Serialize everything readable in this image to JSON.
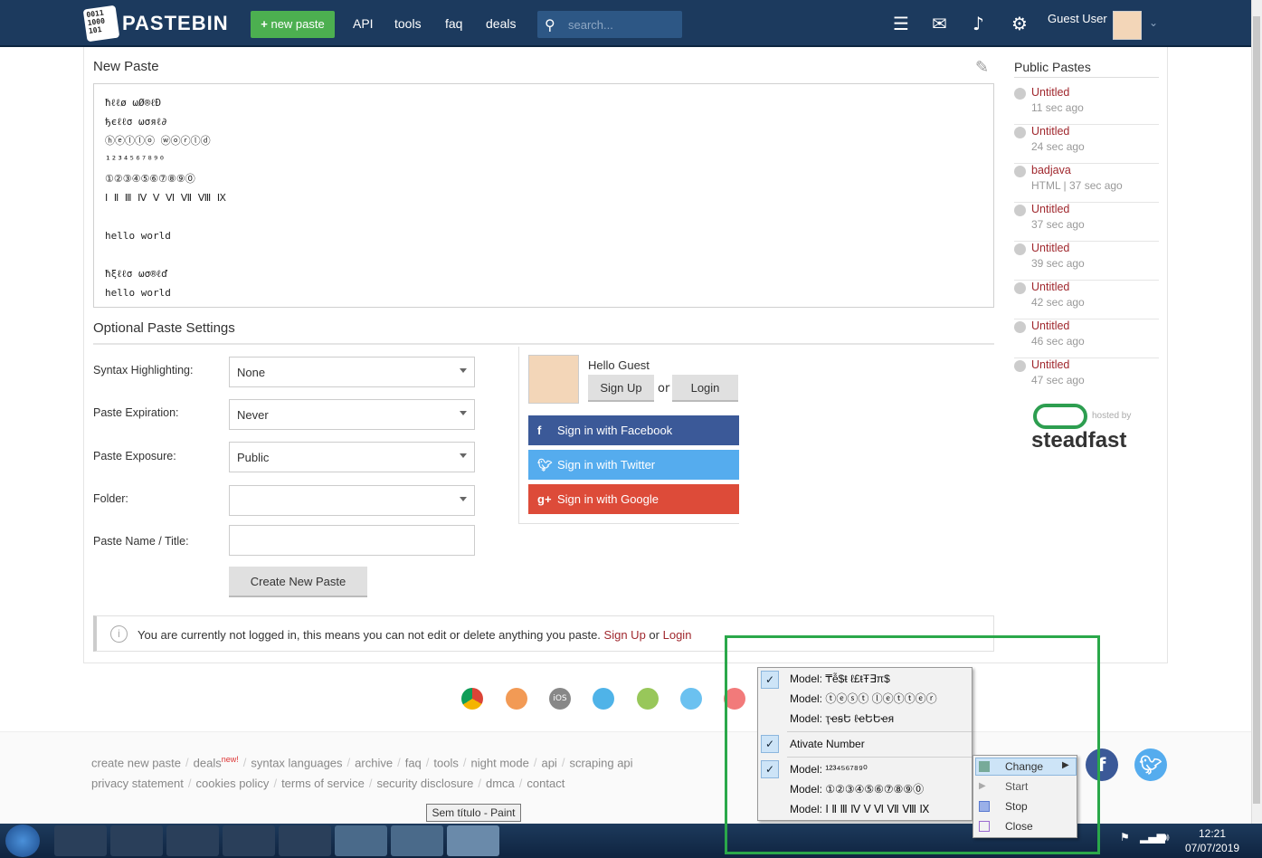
{
  "header": {
    "logo_text": "PASTEBIN",
    "logo_bits": "0011\n1000\n101",
    "new_paste": "new paste",
    "nav": [
      "API",
      "tools",
      "faq",
      "deals"
    ],
    "search_placeholder": "search...",
    "user": "Guest User"
  },
  "editor": {
    "title": "New Paste",
    "content": "ħℓℓø ωØ®ℓÐ\nђєℓℓσ ωσяℓ∂\nⓗⓔⓛⓛⓞ ⓦⓞⓡⓛⓓ\n¹²³⁴⁵⁶⁷⁸⁹⁰\n①②③④⑤⑥⑦⑧⑨⓪\nⅠ Ⅱ Ⅲ Ⅳ Ⅴ Ⅵ Ⅶ Ⅷ Ⅸ\n\nhello world\n\nħξℓℓσ ωσ®ℓď\nhello world"
  },
  "settings": {
    "title": "Optional Paste Settings",
    "rows": [
      {
        "label": "Syntax Highlighting:",
        "value": "None"
      },
      {
        "label": "Paste Expiration:",
        "value": "Never"
      },
      {
        "label": "Paste Exposure:",
        "value": "Public"
      },
      {
        "label": "Folder:",
        "value": ""
      }
    ],
    "name_label": "Paste Name / Title:",
    "create_button": "Create New Paste"
  },
  "login": {
    "hello": "Hello Guest",
    "signup": "Sign Up",
    "or": "or",
    "login": "Login",
    "facebook": "Sign in with Facebook",
    "twitter": "Sign in with Twitter",
    "google": "Sign in with Google"
  },
  "notice": {
    "text": "You are currently not logged in, this means you can not edit or delete anything you paste.",
    "signup": "Sign Up",
    "or": "or",
    "login": "Login"
  },
  "public_pastes": {
    "title": "Public Pastes",
    "items": [
      {
        "title": "Untitled",
        "age": "11 sec ago"
      },
      {
        "title": "Untitled",
        "age": "24 sec ago"
      },
      {
        "title": "badjava",
        "age": "HTML | 37 sec ago"
      },
      {
        "title": "Untitled",
        "age": "37 sec ago"
      },
      {
        "title": "Untitled",
        "age": "39 sec ago"
      },
      {
        "title": "Untitled",
        "age": "42 sec ago"
      },
      {
        "title": "Untitled",
        "age": "46 sec ago"
      },
      {
        "title": "Untitled",
        "age": "47 sec ago"
      }
    ],
    "hosted_by": "hosted by",
    "host": "steadfast"
  },
  "footer": {
    "row1": [
      "create new paste",
      "deals",
      "syntax languages",
      "archive",
      "faq",
      "tools",
      "night mode",
      "api",
      "scraping api"
    ],
    "deals_badge": "new!",
    "row2": [
      "privacy statement",
      "cookies policy",
      "terms of service",
      "security disclosure",
      "dmca",
      "contact"
    ]
  },
  "tooltip": "Sem título - Paint",
  "context_menu": {
    "items": [
      {
        "label": "Model: ₸ễ$ŧ ℓ£ŧŦ∃π$",
        "checked": true
      },
      {
        "label": "Model: ⓣⓔⓢⓣ ⓛⓔⓣⓣⓔⓡ",
        "checked": false
      },
      {
        "label": "Model: ҭҽꞩԵ ℓҽԵԵҽя",
        "checked": false
      },
      {
        "label": "Ativate Number",
        "checked": true
      },
      {
        "label": "Model: ¹²³⁴⁵⁶⁷⁸⁹⁰",
        "checked": true
      },
      {
        "label": "Model: ①②③④⑤⑥⑦⑧⑨⓪",
        "checked": false
      },
      {
        "label": "Model: Ⅰ Ⅱ Ⅲ Ⅳ Ⅴ Ⅵ Ⅶ Ⅷ Ⅸ",
        "checked": false
      }
    ],
    "submenu": [
      "Change",
      "Start",
      "Stop",
      "Close"
    ]
  },
  "clock": {
    "time": "12:21",
    "date": "07/07/2019"
  },
  "colors": {
    "header": "#1c3a5e",
    "accent_green": "#4caf50",
    "link": "#a0282e",
    "facebook": "#3b5998",
    "twitter": "#55acee",
    "google": "#dd4b39",
    "highlight": "#2aa84a"
  }
}
